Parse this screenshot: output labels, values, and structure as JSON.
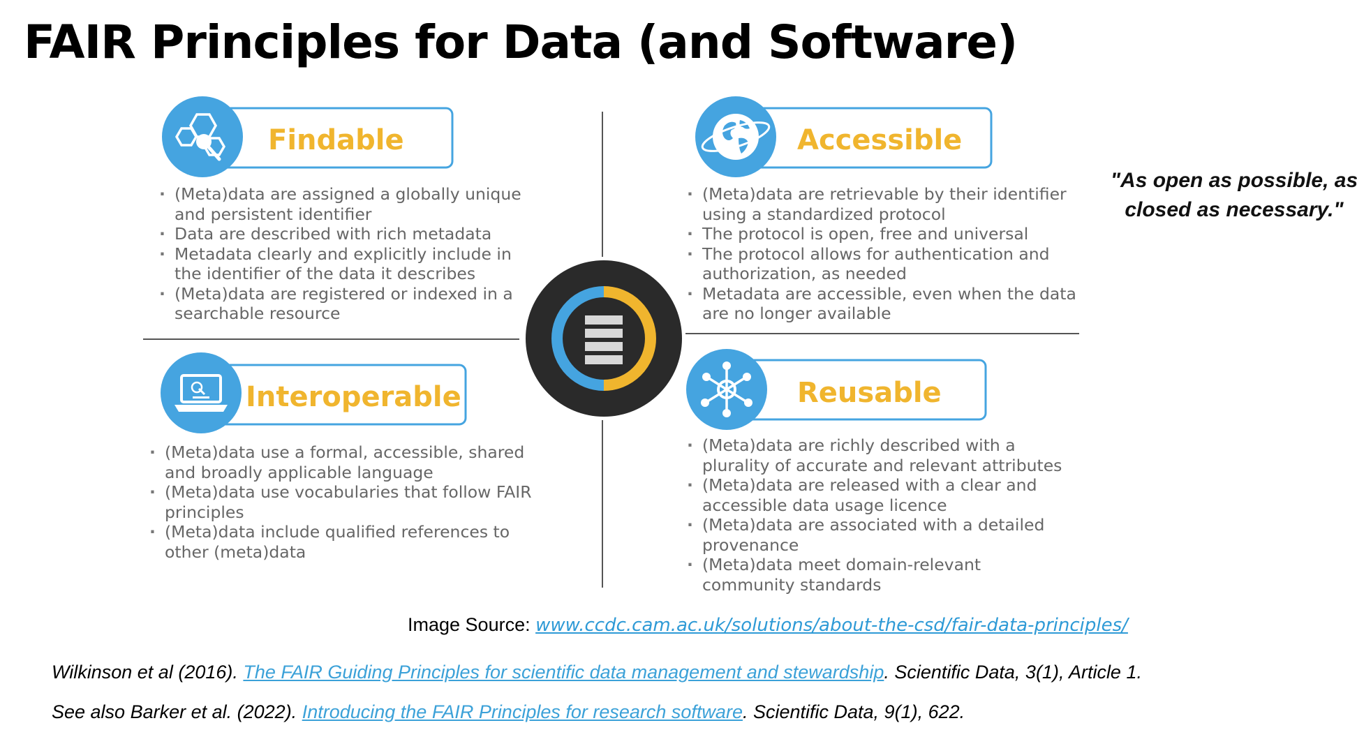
{
  "slide": {
    "title": "FAIR Principles for Data (and Software)",
    "quote_line1": "\"As open as possible, as",
    "quote_line2": "closed as necessary.\""
  },
  "colors": {
    "blue": "#45a4e0",
    "yellow": "#f0b52e",
    "dark": "#2a2a2a",
    "gray_text": "#666666"
  },
  "quadrants": {
    "findable": {
      "title": "Findable",
      "icon": "hexagon-magnifier-icon",
      "items": [
        [
          "(Meta)data are assigned a globally unique",
          "and persistent identifier"
        ],
        [
          "Data are described with rich metadata"
        ],
        [
          "Metadata clearly and explicitly include in",
          "the identifier of the data it describes"
        ],
        [
          "(Meta)data are registered or indexed in a",
          "searchable resource"
        ]
      ]
    },
    "accessible": {
      "title": "Accessible",
      "icon": "globe-icon",
      "items": [
        [
          "(Meta)data are retrievable by their identifier",
          "using a standardized protocol"
        ],
        [
          "The protocol is open, free and universal"
        ],
        [
          "The protocol allows for authentication and",
          "authorization, as needed"
        ],
        [
          "Metadata are accessible, even when the data",
          "are no longer available"
        ]
      ]
    },
    "interoperable": {
      "title": "Interoperable",
      "icon": "laptop-icon",
      "items": [
        [
          "(Meta)data use a formal, accessible, shared",
          "and broadly applicable language"
        ],
        [
          "(Meta)data use vocabularies that follow FAIR",
          "principles"
        ],
        [
          "(Meta)data include qualified references to",
          "other (meta)data"
        ]
      ]
    },
    "reusable": {
      "title": "Reusable",
      "icon": "network-nodes-icon",
      "items": [
        [
          "(Meta)data are richly described with a",
          "plurality of accurate and relevant attributes"
        ],
        [
          "(Meta)data are released with a clear and",
          "accessible data usage licence"
        ],
        [
          "(Meta)data are associated with a detailed",
          "provenance"
        ],
        [
          "(Meta)data meet domain-relevant",
          "community standards"
        ]
      ]
    }
  },
  "center": {
    "icon": "database-stack-icon"
  },
  "source": {
    "label": "Image Source: ",
    "link_text": "www.ccdc.cam.ac.uk/solutions/about-the-csd/fair-data-principles/"
  },
  "references": [
    {
      "prefix": "Wilkinson et al (2016). ",
      "link_text": "The FAIR Guiding Principles for scientific data management and stewardship",
      "suffix": ". Scientific Data, 3(1), Article 1."
    },
    {
      "prefix": "See also Barker et al. (2022). ",
      "link_text": "Introducing the FAIR Principles for research software",
      "suffix": ". Scientific Data, 9(1), 622."
    }
  ]
}
